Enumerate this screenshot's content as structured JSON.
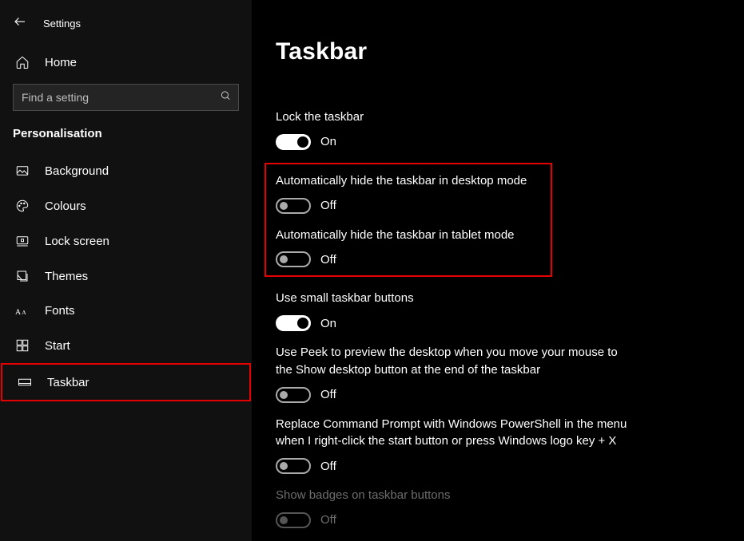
{
  "app_title": "Settings",
  "home_label": "Home",
  "search_placeholder": "Find a setting",
  "category": "Personalisation",
  "sidebar_items": [
    {
      "label": "Background"
    },
    {
      "label": "Colours"
    },
    {
      "label": "Lock screen"
    },
    {
      "label": "Themes"
    },
    {
      "label": "Fonts"
    },
    {
      "label": "Start"
    },
    {
      "label": "Taskbar"
    }
  ],
  "page_title": "Taskbar",
  "toggle_on_label": "On",
  "toggle_off_label": "Off",
  "settings": {
    "lock_taskbar": {
      "label": "Lock the taskbar",
      "on": true
    },
    "auto_hide_desktop": {
      "label": "Automatically hide the taskbar in desktop mode",
      "on": false
    },
    "auto_hide_tablet": {
      "label": "Automatically hide the taskbar in tablet mode",
      "on": false
    },
    "small_buttons": {
      "label": "Use small taskbar buttons",
      "on": true
    },
    "use_peek": {
      "label": "Use Peek to preview the desktop when you move your mouse to the Show desktop button at the end of the taskbar",
      "on": false
    },
    "powershell": {
      "label": "Replace Command Prompt with Windows PowerShell in the menu when I right-click the start button or press Windows logo key + X",
      "on": false
    },
    "show_badges": {
      "label": "Show badges on taskbar buttons",
      "on": false,
      "disabled": true
    }
  }
}
